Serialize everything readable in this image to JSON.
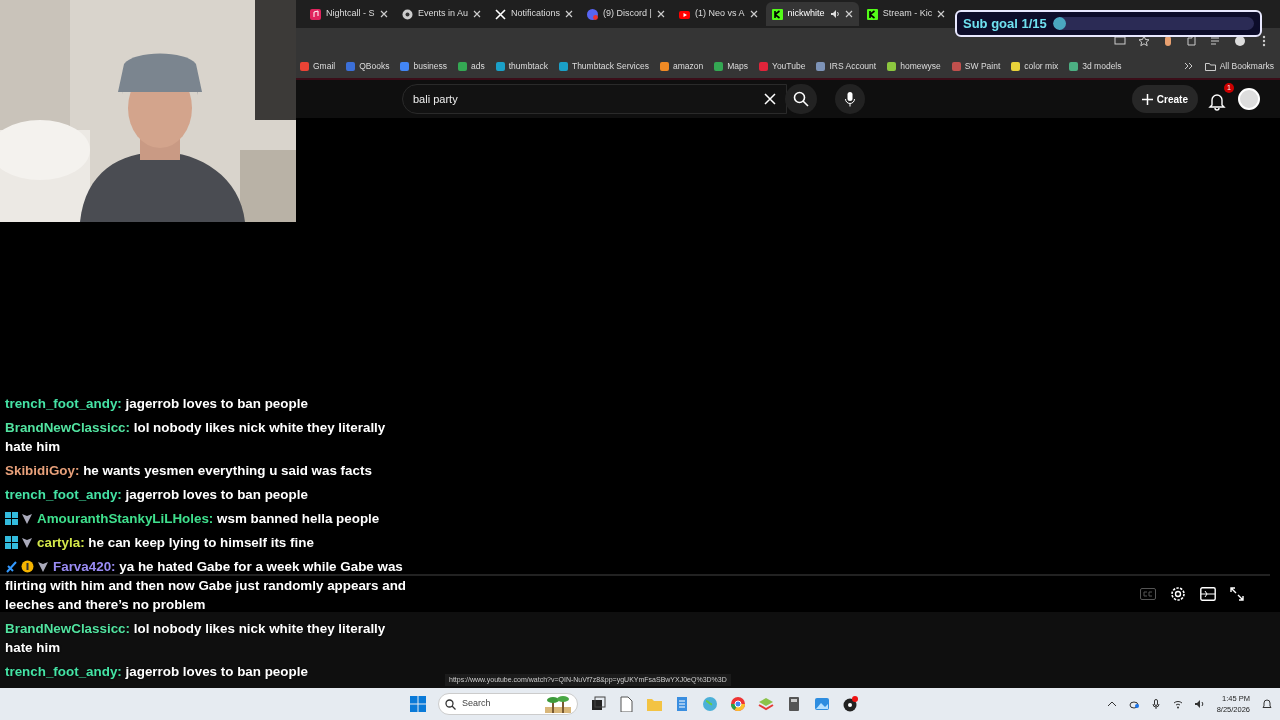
{
  "tabs": [
    {
      "label": "Nightcall - S",
      "kind": "music",
      "selected": false
    },
    {
      "label": "Events in Au",
      "kind": "circle",
      "selected": false
    },
    {
      "label": "Notifications",
      "kind": "x",
      "selected": false
    },
    {
      "label": "(9) Discord |",
      "kind": "discord",
      "selected": false
    },
    {
      "label": "(1) Neo vs A",
      "kind": "youtube",
      "selected": false
    },
    {
      "label": "nickwhite",
      "kind": "kick",
      "selected": true,
      "audio": true
    },
    {
      "label": "Stream - Kic",
      "kind": "kick",
      "selected": false
    }
  ],
  "sub_goal": {
    "label": "Sub goal 1/15",
    "level": 0.067
  },
  "bookmarks": [
    {
      "label": "Gmail",
      "color": "#ea4335"
    },
    {
      "label": "QBooks",
      "color": "#3b6fd8"
    },
    {
      "label": "business",
      "color": "#4285f4"
    },
    {
      "label": "ads",
      "color": "#34a853"
    },
    {
      "label": "thumbtack",
      "color": "#1aa0c8"
    },
    {
      "label": "Thumbtack Services",
      "color": "#1aa0c8"
    },
    {
      "label": "amazon",
      "color": "#f08a24"
    },
    {
      "label": "Maps",
      "color": "#34a853"
    },
    {
      "label": "YouTube",
      "color": "#e0243a"
    },
    {
      "label": "IRS Account",
      "color": "#7d93b8"
    },
    {
      "label": "homewyse",
      "color": "#8cc63f"
    },
    {
      "label": "SW Paint",
      "color": "#c0504d"
    },
    {
      "label": "color mix",
      "color": "#e8d23a"
    },
    {
      "label": "3d models",
      "color": "#4caf82"
    }
  ],
  "all_bookmarks": "All Bookmarks",
  "youtube": {
    "search_value": "bali party",
    "create": "Create",
    "notification_count": "1"
  },
  "chat": [
    {
      "user": "trench_foot_andy:",
      "color": "#45e3a5",
      "text": "jagerrob loves to ban people"
    },
    {
      "user": "BrandNewClassicc:",
      "color": "#52e3a0",
      "text": "lol nobody likes nick white they literally hate him"
    },
    {
      "user": "SkibidiGoy:",
      "color": "#e7a07a",
      "text": "he wants yesmen everything u said was facts"
    },
    {
      "user": "trench_foot_andy:",
      "color": "#45e3a5",
      "text": "jagerrob loves to ban people"
    },
    {
      "user": "AmouranthStankyLiLHoles:",
      "color": "#3fe08d",
      "badges": [
        {
          "kind": "og"
        },
        {
          "kind": "shield"
        }
      ],
      "text": "wsm banned hella people"
    },
    {
      "user": "cartyla:",
      "color": "#d4e84a",
      "badges": [
        {
          "kind": "og"
        },
        {
          "kind": "shield"
        }
      ],
      "text": "he can keep lying to himself its fine"
    },
    {
      "user": "Farva420:",
      "color": "#9a8cf5",
      "badges": [
        {
          "kind": "sword"
        },
        {
          "kind": "coin"
        },
        {
          "kind": "shield"
        }
      ],
      "text": "ya he hated Gabe for a week while Gabe was flirting with him and then now Gabe just randomly appears and leeches and there’s no problem"
    },
    {
      "user": "BrandNewClassicc:",
      "color": "#52e3a0",
      "text": "lol nobody likes nick white they literally hate him"
    },
    {
      "user": "trench_foot_andy:",
      "color": "#45e3a5",
      "text": "jagerrob loves to ban people"
    }
  ],
  "status_url": "https://www.youtube.com/watch?v=QIN-NuVf7z8&pp=ygUKYmFsaSBwYXJ0eQ%3D%3D",
  "taskbar": {
    "search_placeholder": "Search",
    "time": "1:45 PM",
    "date": "8/25/2026"
  }
}
